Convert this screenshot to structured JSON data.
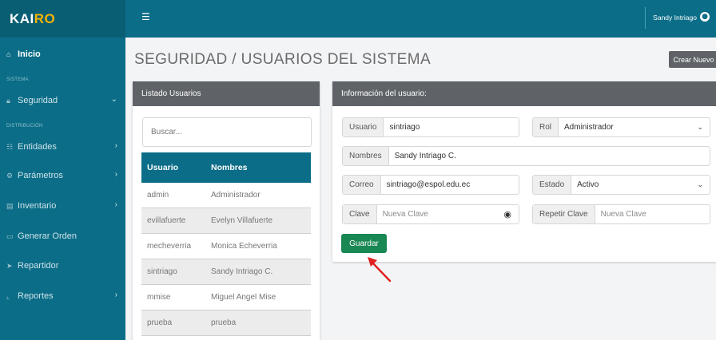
{
  "brand": {
    "part1": "KAI",
    "part2": "RO"
  },
  "topbar": {
    "menu_icon": "hamburger-icon",
    "user_name": "Sandy Intriago",
    "user_icon": "user-circle-icon"
  },
  "sidebar": {
    "inicio": "Inicio",
    "section_sistema": "SISTEMA",
    "seguridad": "Seguridad",
    "section_distribucion": "DISTRIBUCIÓN",
    "entidades": "Entidades",
    "parametros": "Parámetros",
    "inventario": "Inventario",
    "generar_orden": "Generar Orden",
    "repartidor": "Repartidor",
    "reportes": "Reportes"
  },
  "main": {
    "title": "SEGURIDAD / USUARIOS DEL SISTEMA",
    "create_button": "Crear Nuevo"
  },
  "list": {
    "header": "Listado Usuarios",
    "search_placeholder": "Buscar...",
    "columns": [
      "Usuario",
      "Nombres"
    ],
    "rows": [
      [
        "admin",
        "Administrador"
      ],
      [
        "evillafuerte",
        "Evelyn Villafuerte"
      ],
      [
        "mecheverria",
        "Monica Echeverria"
      ],
      [
        "sintriago",
        "Sandy Intriago C."
      ],
      [
        "mmise",
        "Miguel Angel Mise"
      ],
      [
        "prueba",
        "prueba"
      ]
    ]
  },
  "form": {
    "header": "Información del usuario:",
    "usuario_label": "Usuario",
    "usuario_value": "sintriago",
    "rol_label": "Rol",
    "rol_value": "Administrador",
    "nombres_label": "Nombres",
    "nombres_value": "Sandy Intriago C.",
    "correo_label": "Correo",
    "correo_value": "sintriago@espol.edu.ec",
    "estado_label": "Estado",
    "estado_value": "Activo",
    "clave_label": "Clave",
    "clave_placeholder": "Nueva Clave",
    "repetir_label": "Repetir Clave",
    "repetir_placeholder": "Nueva Clave",
    "save_button": "Guardar"
  },
  "colors": {
    "primary": "#0b6d87",
    "brand_accent": "#f5b301",
    "header_gray": "#5f6368",
    "success": "#198754",
    "annotation": "#e02020"
  }
}
